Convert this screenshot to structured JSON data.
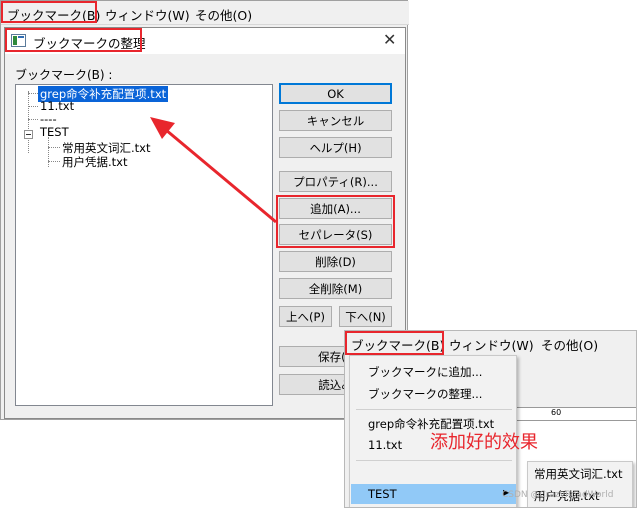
{
  "main": {
    "menu": [
      "ブックマーク(B)",
      "ウィンドウ(W)",
      "その他(O)"
    ]
  },
  "dialog": {
    "title": "ブックマークの整理",
    "close_glyph": "✕",
    "list_label": "ブックマーク(B) :",
    "tree": [
      {
        "label": "grep命令补充配置项.txt",
        "depth": 0,
        "selected": true
      },
      {
        "label": "11.txt",
        "depth": 0
      },
      {
        "label": "----",
        "depth": 0
      },
      {
        "label": "TEST",
        "depth": 0,
        "expanded": true
      },
      {
        "label": "常用英文词汇.txt",
        "depth": 1
      },
      {
        "label": "用户凭据.txt",
        "depth": 1
      }
    ],
    "buttons": {
      "ok": "OK",
      "cancel": "キャンセル",
      "help": "ヘルプ(H)",
      "properties": "プロパティ(R)...",
      "add": "追加(A)...",
      "separator": "セパレータ(S)",
      "delete": "削除(D)",
      "delete_all": "全削除(M)",
      "up": "上へ(P)",
      "down": "下へ(N)",
      "save": "保存(E",
      "load": "読込み"
    }
  },
  "result": {
    "menu": [
      "ブックマーク(B)",
      "ウィンドウ(W)",
      "その他(O)"
    ],
    "ruler_mark": "60",
    "dropdown": [
      "ブックマークに追加...",
      "ブックマークの整理...",
      "grep命令补充配置项.txt",
      "11.txt",
      "TEST"
    ],
    "submenu": [
      "常用英文词汇.txt",
      "用户凭据.txt"
    ],
    "submenu_arrow": "▶"
  },
  "caption": "添加好的效果",
  "watermark": "CSDN @CrazyRoadWorld",
  "colors": {
    "annotation": "#e8262d",
    "selection": "#0a64d8",
    "menu_highlight": "#91c9f7"
  }
}
